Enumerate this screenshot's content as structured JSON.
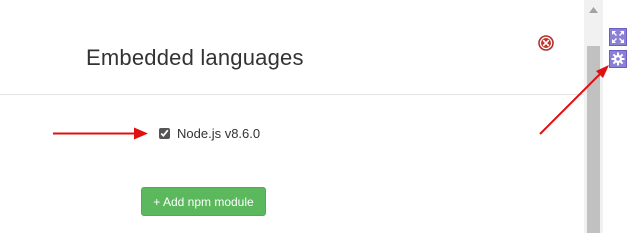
{
  "dialog": {
    "title": "Embedded languages",
    "checkbox_label": "Node.js v8.6.0",
    "checkbox_checked": true,
    "add_button_label": "+ Add npm module"
  },
  "colors": {
    "add_button": "#5cb85c",
    "close_icon": "#c0392b",
    "side_buttons": "#8b7fd6",
    "arrows": "#e01010"
  },
  "icons": {
    "close": "close-icon",
    "expand": "expand-icon",
    "settings": "gear-icon"
  }
}
